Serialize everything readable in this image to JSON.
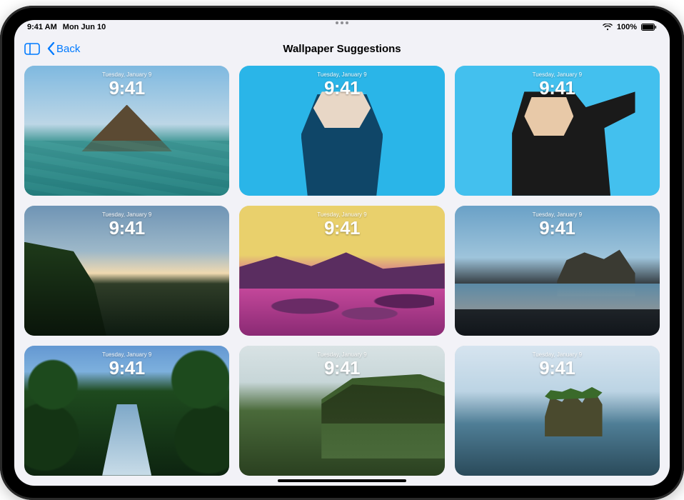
{
  "status": {
    "time": "9:41 AM",
    "date": "Mon Jun 10",
    "battery_percent": "100%"
  },
  "nav": {
    "back_label": "Back",
    "title": "Wallpaper Suggestions"
  },
  "tile_overlay": {
    "date": "Tuesday, January 9",
    "time": "9:41"
  },
  "tiles": [
    {
      "id": "volcano",
      "bg_class": "bg-volcano",
      "desc": "Volcano island with turquoise sea"
    },
    {
      "id": "portrait-a",
      "bg_class": "bg-portrait-a",
      "desc": "Duotone cyan portrait, bubble gum"
    },
    {
      "id": "portrait-b",
      "bg_class": "bg-portrait-b",
      "desc": "Portrait on cyan, selfie pose"
    },
    {
      "id": "cliff-sunset",
      "bg_class": "bg-cliff-sunset",
      "desc": "Green cliff silhouette at sunset"
    },
    {
      "id": "duocoast",
      "bg_class": "bg-duocoast",
      "desc": "Duotone yellow-magenta rocky coast"
    },
    {
      "id": "blacksand",
      "bg_class": "bg-blacksand",
      "desc": "Rock formation on black sand beach"
    },
    {
      "id": "jungle",
      "bg_class": "bg-jungle",
      "desc": "Jungle stream with foliage"
    },
    {
      "id": "highland",
      "bg_class": "bg-highland",
      "desc": "Green highland cliff landscape"
    },
    {
      "id": "seastack",
      "bg_class": "bg-seastack",
      "desc": "Sea stack island in ocean"
    }
  ]
}
